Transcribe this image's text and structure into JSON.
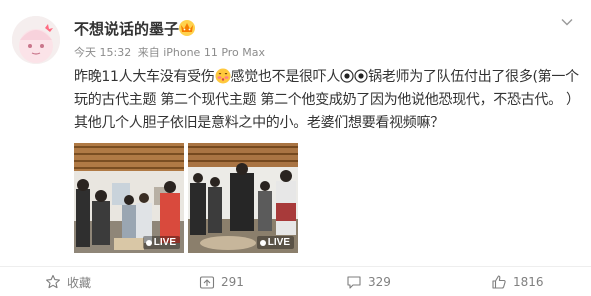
{
  "post": {
    "username": "不想说话的墨子",
    "meta": {
      "time": "今天 15:32",
      "source": "来自 iPhone 11 Pro Max"
    },
    "text": {
      "part1": "昨晚11人大车没有受伤",
      "part2": "感觉也不是很吓人",
      "part3": "锅老师为了队伍付出了很多(第一个玩的古代主题 第二个现代主题 第二个他变成奶了因为他说他恐现代，不恐古代。 ）其他几个人胆子依旧是意料之中的小。老婆们想要看视频嘛？"
    },
    "photos": [
      {
        "badge": "LIVE"
      },
      {
        "badge": "LIVE"
      }
    ]
  },
  "actions": {
    "favorite": "收藏",
    "repost": "291",
    "comment": "329",
    "like": "1816"
  },
  "icons": {
    "vip": "vip-crown-icon",
    "emoji": "blush-emoji-icon",
    "eyes": "eyes-emoji-icon",
    "menu": "chevron-down-icon",
    "favorite": "star-icon",
    "repost": "repost-icon",
    "comment": "comment-icon",
    "like": "thumbs-up-icon"
  },
  "colors": {
    "text": "#333333",
    "meta": "#8c8c8c",
    "vip": "#f5a623",
    "emoji": "#ffc83d"
  }
}
